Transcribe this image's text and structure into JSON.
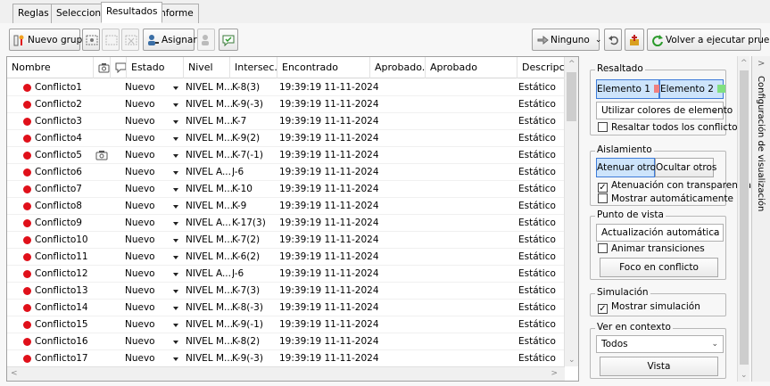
{
  "tabs": [
    {
      "label": "Reglas",
      "active": false
    },
    {
      "label": "Seleccionar",
      "active": false
    },
    {
      "label": "Resultados",
      "active": true
    },
    {
      "label": "Informe",
      "active": false
    }
  ],
  "toolbar": {
    "new_group": "Nuevo grupo",
    "assign": "Asignar",
    "none": "Ninguno",
    "rerun": "Volver a ejecutar prueba"
  },
  "table": {
    "columns": [
      "Nombre",
      "",
      "",
      "Estado",
      "Nivel",
      "Intersec...",
      "Encontrado",
      "Aprobado...",
      "Aprobado",
      "Descripción"
    ],
    "rows": [
      {
        "name": "Conflicto1",
        "status": "Nuevo",
        "level": "NIVEL M...",
        "inter": "K-8(3)",
        "found": "19:39:19 11-11-2024",
        "desc": "Estático",
        "cam": false
      },
      {
        "name": "Conflicto2",
        "status": "Nuevo",
        "level": "NIVEL M...",
        "inter": "K-9(-3)",
        "found": "19:39:19 11-11-2024",
        "desc": "Estático",
        "cam": false
      },
      {
        "name": "Conflicto3",
        "status": "Nuevo",
        "level": "NIVEL M...",
        "inter": "K-7",
        "found": "19:39:19 11-11-2024",
        "desc": "Estático",
        "cam": false
      },
      {
        "name": "Conflicto4",
        "status": "Nuevo",
        "level": "NIVEL M...",
        "inter": "K-9(2)",
        "found": "19:39:19 11-11-2024",
        "desc": "Estático",
        "cam": false
      },
      {
        "name": "Conflicto5",
        "status": "Nuevo",
        "level": "NIVEL M...",
        "inter": "K-7(-1)",
        "found": "19:39:19 11-11-2024",
        "desc": "Estático",
        "cam": true
      },
      {
        "name": "Conflicto6",
        "status": "Nuevo",
        "level": "NIVEL A...",
        "inter": "J-6",
        "found": "19:39:19 11-11-2024",
        "desc": "Estático",
        "cam": false
      },
      {
        "name": "Conflicto7",
        "status": "Nuevo",
        "level": "NIVEL M...",
        "inter": "K-10",
        "found": "19:39:19 11-11-2024",
        "desc": "Estático",
        "cam": false
      },
      {
        "name": "Conflicto8",
        "status": "Nuevo",
        "level": "NIVEL M...",
        "inter": "K-9",
        "found": "19:39:19 11-11-2024",
        "desc": "Estático",
        "cam": false
      },
      {
        "name": "Conflicto9",
        "status": "Nuevo",
        "level": "NIVEL A...",
        "inter": "K-17(3)",
        "found": "19:39:19 11-11-2024",
        "desc": "Estático",
        "cam": false
      },
      {
        "name": "Conflicto10",
        "status": "Nuevo",
        "level": "NIVEL M...",
        "inter": "K-7(2)",
        "found": "19:39:19 11-11-2024",
        "desc": "Estático",
        "cam": false
      },
      {
        "name": "Conflicto11",
        "status": "Nuevo",
        "level": "NIVEL M...",
        "inter": "K-6(2)",
        "found": "19:39:19 11-11-2024",
        "desc": "Estático",
        "cam": false
      },
      {
        "name": "Conflicto12",
        "status": "Nuevo",
        "level": "NIVEL A...",
        "inter": "J-6",
        "found": "19:39:19 11-11-2024",
        "desc": "Estático",
        "cam": false
      },
      {
        "name": "Conflicto13",
        "status": "Nuevo",
        "level": "NIVEL M...",
        "inter": "K-7(3)",
        "found": "19:39:19 11-11-2024",
        "desc": "Estático",
        "cam": false
      },
      {
        "name": "Conflicto14",
        "status": "Nuevo",
        "level": "NIVEL M...",
        "inter": "K-8(-3)",
        "found": "19:39:19 11-11-2024",
        "desc": "Estático",
        "cam": false
      },
      {
        "name": "Conflicto15",
        "status": "Nuevo",
        "level": "NIVEL M...",
        "inter": "K-9(-1)",
        "found": "19:39:19 11-11-2024",
        "desc": "Estático",
        "cam": false
      },
      {
        "name": "Conflicto16",
        "status": "Nuevo",
        "level": "NIVEL M...",
        "inter": "K-8(2)",
        "found": "19:39:19 11-11-2024",
        "desc": "Estático",
        "cam": false
      },
      {
        "name": "Conflicto17",
        "status": "Nuevo",
        "level": "NIVEL M...",
        "inter": "K-9(-3)",
        "found": "19:39:19 11-11-2024",
        "desc": "Estático",
        "cam": false
      }
    ]
  },
  "side": {
    "highlight": {
      "title": "Resaltado",
      "elem1": "Elemento 1",
      "elem2": "Elemento 2",
      "elem1_color": "#f08080",
      "elem2_color": "#80e080",
      "combo": "Utilizar colores de elemento",
      "chk_all": "Resaltar todos los conflictos"
    },
    "isolation": {
      "title": "Aislamiento",
      "dim": "Atenuar otros",
      "hide": "Ocultar otros",
      "chk_transp": "Atenuación con transparencia",
      "chk_auto": "Mostrar automáticamente"
    },
    "viewpoint": {
      "title": "Punto de vista",
      "combo": "Actualización automática",
      "chk_anim": "Animar transiciones",
      "focus": "Foco en conflicto"
    },
    "simulation": {
      "title": "Simulación",
      "chk_show": "Mostrar simulación"
    },
    "context": {
      "title": "Ver en contexto",
      "combo": "Todos",
      "view": "Vista"
    }
  },
  "vertical_tab": "Configuración de visualización"
}
